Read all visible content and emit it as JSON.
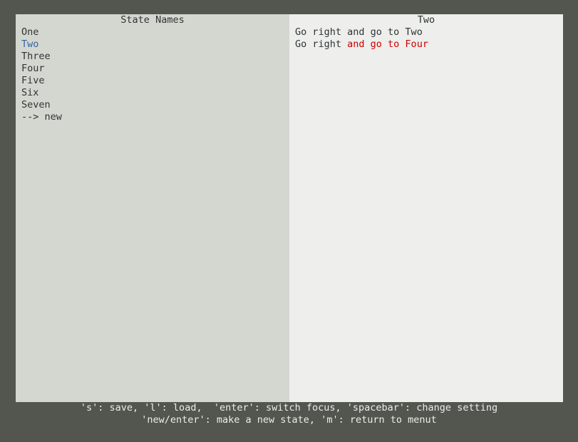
{
  "left_panel": {
    "title": "State Names",
    "items": [
      {
        "label": "One",
        "selected": false
      },
      {
        "label": "Two",
        "selected": true
      },
      {
        "label": "Three",
        "selected": false
      },
      {
        "label": "Four",
        "selected": false
      },
      {
        "label": "Five",
        "selected": false
      },
      {
        "label": "Six",
        "selected": false
      },
      {
        "label": "Seven",
        "selected": false
      },
      {
        "label": "--> new",
        "selected": false
      }
    ]
  },
  "right_panel": {
    "title": "Two",
    "lines": [
      {
        "prefix": "Go right ",
        "highlight": "",
        "plain": "and go to Two"
      },
      {
        "prefix": "Go right ",
        "highlight": "and go to Four",
        "plain": ""
      }
    ]
  },
  "footer": {
    "line1": "'s': save, 'l': load,  'enter': switch focus, 'spacebar': change setting",
    "line2": "'new/enter': make a new state, 'm': return to menut"
  },
  "colors": {
    "background": "#53554f",
    "left_panel_bg": "#d3d7cf",
    "right_panel_bg": "#eeeeec",
    "text": "#2e3436",
    "selected_text": "#3465a4",
    "highlight_text": "#cc0000",
    "footer_text": "#eeeeec"
  }
}
